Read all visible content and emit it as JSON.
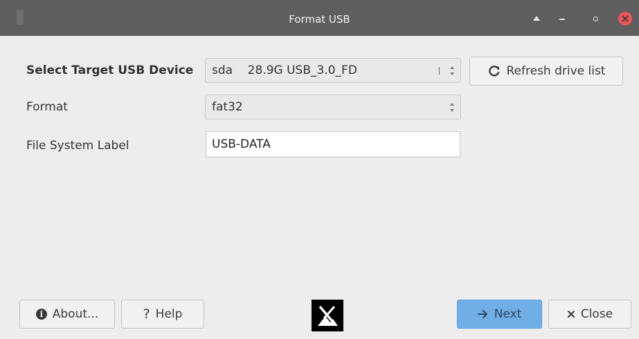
{
  "window": {
    "title": "Format USB"
  },
  "form": {
    "target_label": "Select Target USB Device",
    "target_device": "sda    28.9G USB_3.0_FD",
    "refresh_label": "Refresh drive list",
    "format_label": "Format",
    "format_value": "fat32",
    "fs_label_label": "File System Label",
    "fs_label_value": "USB-DATA"
  },
  "footer": {
    "about_label": "About...",
    "help_label": "Help",
    "next_label": "Next",
    "close_label": "Close"
  },
  "icons": {
    "refresh": "refresh-icon",
    "info": "info-icon",
    "help": "help-icon",
    "next": "arrow-right-icon",
    "close": "close-icon",
    "logo": "mx-logo-icon"
  },
  "colors": {
    "titlebar": "#5e5e5e",
    "primary_button": "#71aee6",
    "close_window": "#e6575a"
  }
}
